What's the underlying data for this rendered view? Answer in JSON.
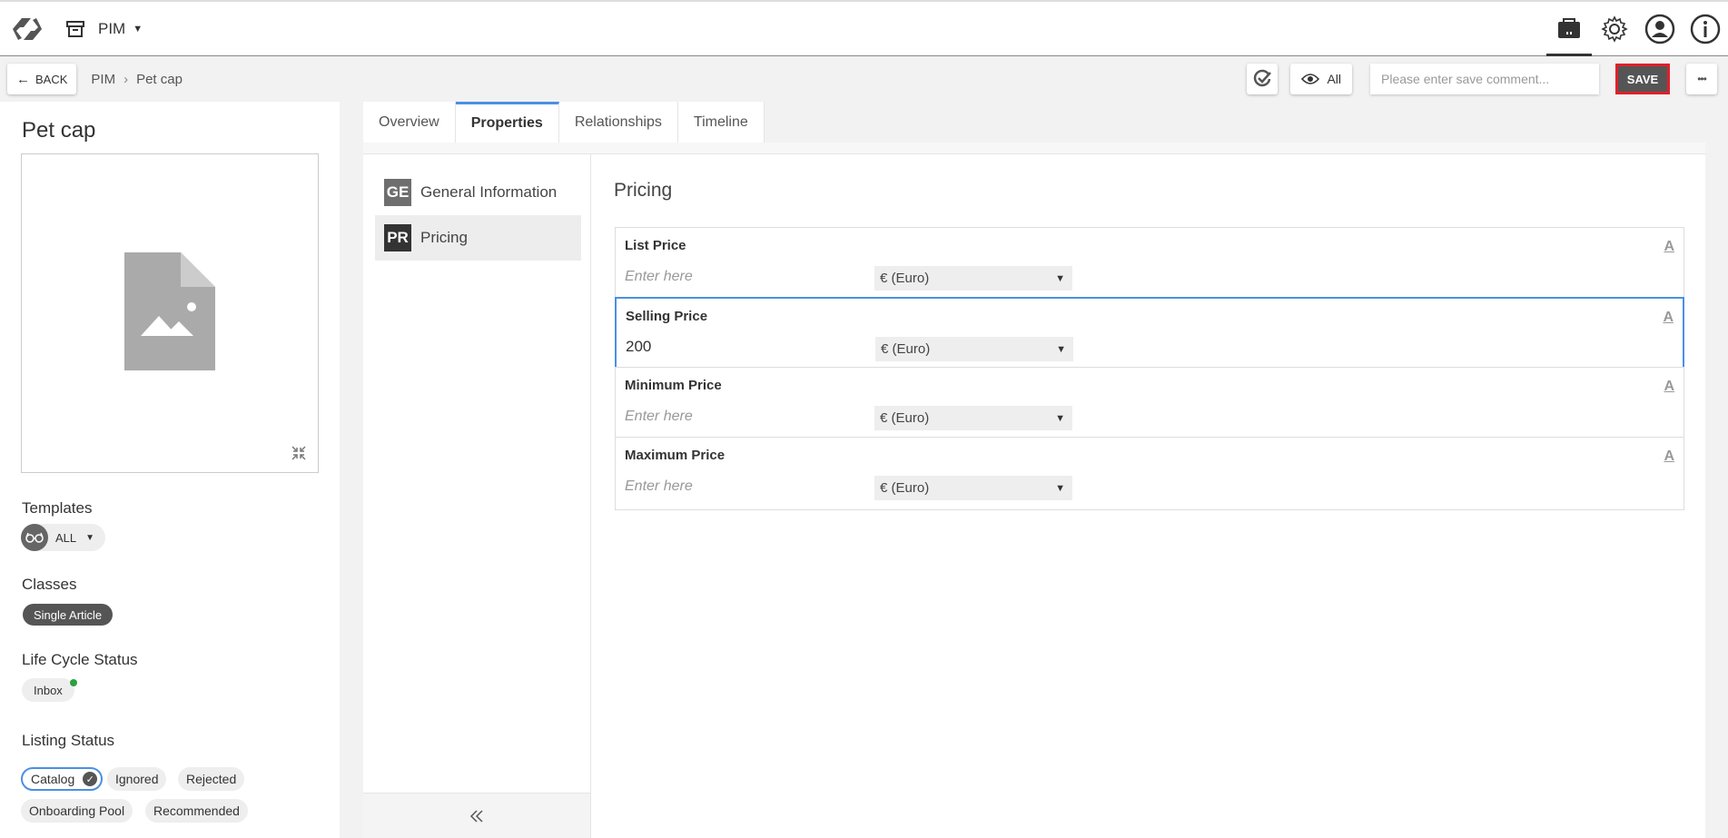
{
  "app": {
    "module_label": "PIM",
    "icons": [
      "logo-icon",
      "archive-icon",
      "product-icon",
      "settings-icon",
      "user-icon",
      "info-icon"
    ]
  },
  "subbar": {
    "back_label": "BACK",
    "breadcrumb": [
      "PIM",
      "Pet cap"
    ],
    "breadcrumb_sep": "›",
    "view_label": "All",
    "save_comment_placeholder": "Please enter save comment...",
    "save_label": "SAVE",
    "more_label": "•••"
  },
  "product": {
    "title": "Pet cap",
    "templates_label": "Templates",
    "template_value": "ALL",
    "classes_label": "Classes",
    "class_value": "Single Article",
    "lifecycle_label": "Life Cycle Status",
    "lifecycle_value": "Inbox",
    "listing_label": "Listing Status",
    "listing_statuses": [
      "Catalog",
      "Ignored",
      "Rejected",
      "Onboarding Pool",
      "Recommended"
    ],
    "listing_selected": "Catalog"
  },
  "tabs": [
    "Overview",
    "Properties",
    "Relationships",
    "Timeline"
  ],
  "active_tab": "Properties",
  "groups": [
    {
      "abbr": "GE",
      "name": "General Information"
    },
    {
      "abbr": "PR",
      "name": "Pricing"
    }
  ],
  "active_group": "Pricing",
  "form": {
    "title": "Pricing",
    "fields": [
      {
        "label": "List Price",
        "value": "",
        "placeholder": "Enter here",
        "currency": "€ (Euro)"
      },
      {
        "label": "Selling Price",
        "value": "200",
        "placeholder": "Enter here",
        "currency": "€ (Euro)"
      },
      {
        "label": "Minimum Price",
        "value": "",
        "placeholder": "Enter here",
        "currency": "€ (Euro)"
      },
      {
        "label": "Maximum Price",
        "value": "",
        "placeholder": "Enter here",
        "currency": "€ (Euro)"
      }
    ],
    "font_icon_glyph": "A"
  },
  "colors": {
    "accent": "#4a90e2",
    "save_bg": "#555555",
    "save_border": "#e0202a",
    "status_dot": "#2ea043"
  }
}
